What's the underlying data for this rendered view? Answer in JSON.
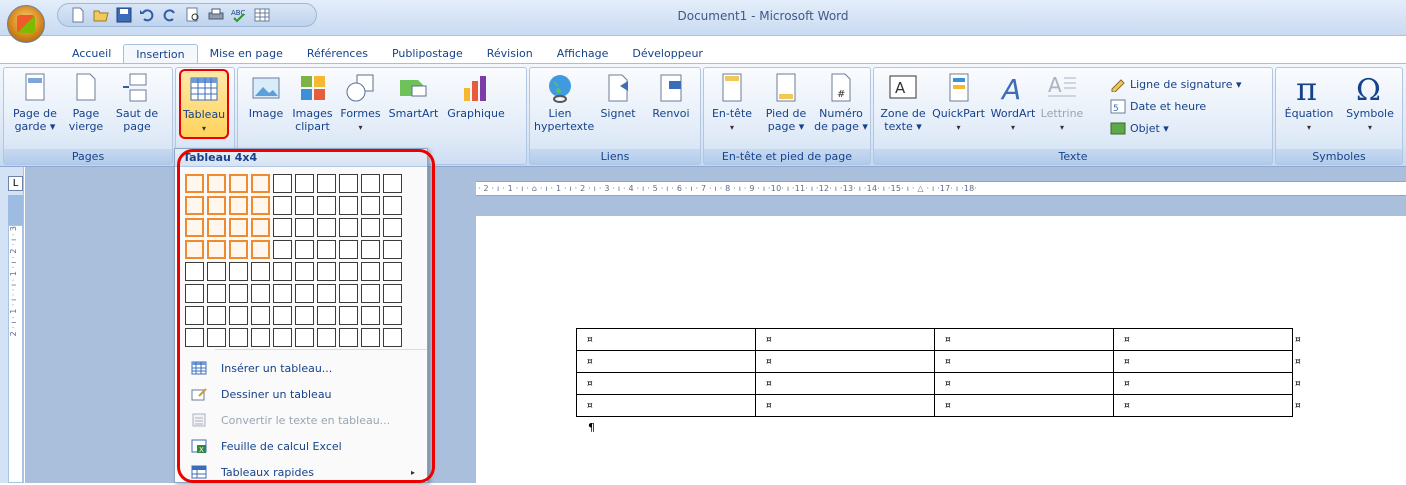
{
  "window": {
    "title": "Document1 - Microsoft Word"
  },
  "quick_access": {
    "icons": [
      "new-doc-icon",
      "open-icon",
      "save-icon",
      "undo-icon",
      "redo-icon",
      "print-preview-icon",
      "print-icon",
      "spelling-icon",
      "table-icon"
    ]
  },
  "tabs": [
    "Accueil",
    "Insertion",
    "Mise en page",
    "Références",
    "Publipostage",
    "Révision",
    "Affichage",
    "Développeur"
  ],
  "active_tab": "Insertion",
  "ribbon": {
    "pages": {
      "label": "Pages",
      "cover": "Page de garde ▾",
      "blank": "Page vierge",
      "break": "Saut de page"
    },
    "tableaux": {
      "tableau": "Tableau",
      "arrow": "▾"
    },
    "illustrations": {
      "image": "Image",
      "clipart": "Images clipart",
      "formes": "Formes",
      "smartart": "SmartArt",
      "graphique": "Graphique",
      "arrow": "▾"
    },
    "liens": {
      "label": "Liens",
      "lien": "Lien hypertexte",
      "signet": "Signet",
      "renvoi": "Renvoi"
    },
    "entete": {
      "label": "En-tête et pied de page",
      "entete": "En-tête",
      "pied": "Pied de page ▾",
      "numero": "Numéro de page ▾",
      "arrow": "▾"
    },
    "texte": {
      "label": "Texte",
      "zone": "Zone de texte ▾",
      "quickpart": "QuickPart",
      "wordart": "WordArt",
      "lettrine": "Lettrine",
      "signature": "Ligne de signature ▾",
      "date": "Date et heure",
      "objet": "Objet ▾",
      "arrow": "▾"
    },
    "symboles": {
      "label": "Symboles",
      "equation": "Équation",
      "symbole": "Symbole",
      "arrow": "▾"
    }
  },
  "dropdown": {
    "title": "Tableau 4x4",
    "grid": {
      "columns": 10,
      "rows": 8,
      "selected_columns": 4,
      "selected_rows": 4
    },
    "items": [
      {
        "label": "Insérer un tableau...",
        "icon": "insert-table-icon",
        "enabled": true
      },
      {
        "label": "Dessiner un tableau",
        "icon": "draw-table-icon",
        "enabled": true
      },
      {
        "label": "Convertir le texte en tableau...",
        "icon": "convert-text-icon",
        "enabled": false
      },
      {
        "label": "Feuille de calcul Excel",
        "icon": "excel-icon",
        "enabled": true
      },
      {
        "label": "Tableaux rapides",
        "icon": "quick-tables-icon",
        "enabled": true,
        "submenu": "▸"
      }
    ]
  },
  "ruler": {
    "corner": "L",
    "text": "· 2 · ı · 1 · ı · ⌂ · ı · 1 · ı · 2 · ı · 3 · ı · 4 · ı · 5 · ı · 6 · ı · 7 · ı · 8 · ı · 9 · ı ·10· ı ·11· ı ·12· ı ·13· ı ·14· ı ·15· ı · △ · ı ·17· ı ·18·",
    "vertical": "2 · ı · 1 · ı · · ı · 1 · ı · 2 · ı · 3"
  },
  "document": {
    "cell_mark": "¤",
    "paragraph_mark": "¶",
    "rows": 4,
    "columns": 4
  }
}
